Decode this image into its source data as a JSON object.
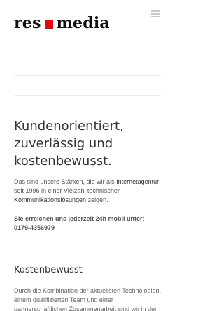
{
  "header": {
    "logo": {
      "part1": "res",
      "part2": "media",
      "square_color": "#e30613"
    },
    "menu_icon": "hamburger-menu-icon"
  },
  "main": {
    "headline": "Kundenorientiert, zuverlässig und kostenbewusst.",
    "intro": {
      "t1": "Das sind unsere Stärken, die wir als ",
      "l1": "Internetagentur",
      "t2": " seit 1996 in einer Vielzahl technischer ",
      "l2": "Kommunikationslösungen",
      "t3": " zeigen."
    },
    "contact": {
      "line1": "Sie erreichen uns jederzeit 24h mobil unter:",
      "phone": "0179-4356979"
    },
    "section": {
      "title": "Kostenbewusst",
      "text": "Durch die Kombination der aktuellsten Technologien, einem qualifizierten Team und einer partnerschaftlichen Zusammenarbeit sind wir in der"
    }
  }
}
